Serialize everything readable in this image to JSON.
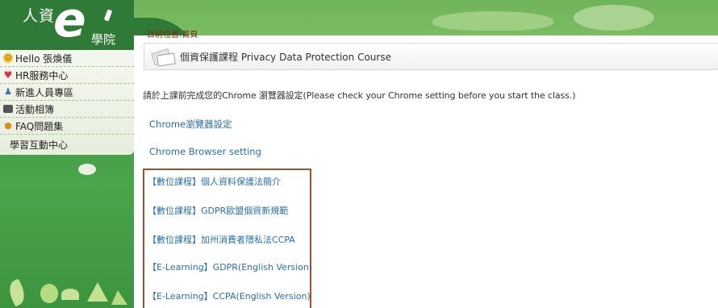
{
  "logo": {
    "title": "人資",
    "letter": "e",
    "subtitle": "學院"
  },
  "sidebar": {
    "items": [
      {
        "label": "Hello 張煥儀",
        "icon": "smiley-icon"
      },
      {
        "label": "HR服務中心",
        "icon": "heart-icon"
      },
      {
        "label": "新進人員專區",
        "icon": "people-icon"
      },
      {
        "label": "活動相簿",
        "icon": "camera-icon"
      },
      {
        "label": "FAQ問題集",
        "icon": "lightbulb-icon"
      },
      {
        "label": "學習互動中心",
        "icon": ""
      }
    ]
  },
  "breadcrumb": "目前位置:首頁",
  "course": {
    "title": "個資保護課程 Privacy Data Protection Course"
  },
  "instruction": "請於上課前完成您的Chrome 瀏覽器設定(Please check your Chrome setting  before you start the class.)",
  "links": {
    "chrome_zh": "Chrome瀏覽器設定",
    "chrome_en": "Chrome Browser setting"
  },
  "courses": [
    "【數位課程】個人資料保護法簡介",
    "【數位課程】GDPR歐盟個資新規範",
    "【數位課程】加州消費者隱私法CCPA",
    "【E-Learning】GDPR(English Version)",
    "【E-Learning】CCPA(English Version)"
  ],
  "colors": {
    "sidebar_green": "#3f9a45",
    "banner_green": "#7cbd62",
    "link_blue": "#2870a8",
    "box_border": "#a0522d",
    "breadcrumb": "#7a2d10"
  }
}
